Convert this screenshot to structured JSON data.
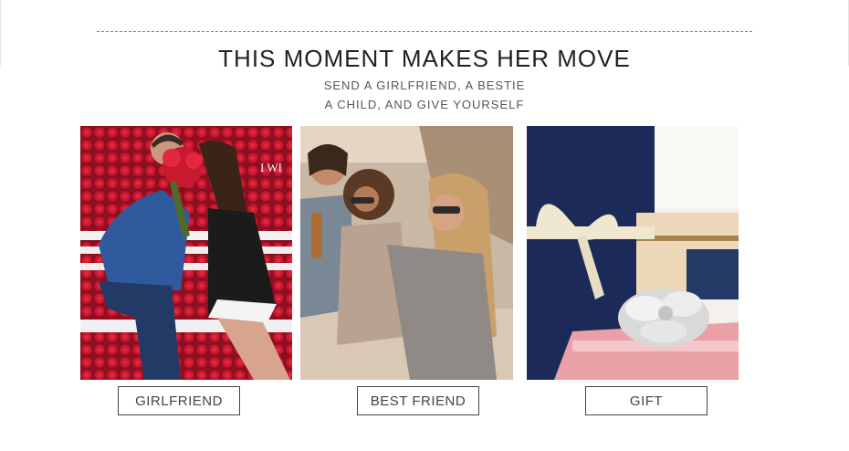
{
  "header": {
    "title": "THIS MOMENT MAKES HER MOVE",
    "subtitle_line1": "SEND A GIRLFRIEND, A BESTIE",
    "subtitle_line2": "A CHILD, AND GIVE YOURSELF"
  },
  "cards": [
    {
      "label": "GIRLFRIEND",
      "photo_text": "I WI"
    },
    {
      "label": "BEST FRIEND"
    },
    {
      "label": "GIFT"
    }
  ],
  "colors": {
    "rose_red": "#b0132a",
    "navy_box": "#1c2a5a",
    "ribbon": "#efe7cf",
    "pink_box": "#e9a0a6"
  }
}
